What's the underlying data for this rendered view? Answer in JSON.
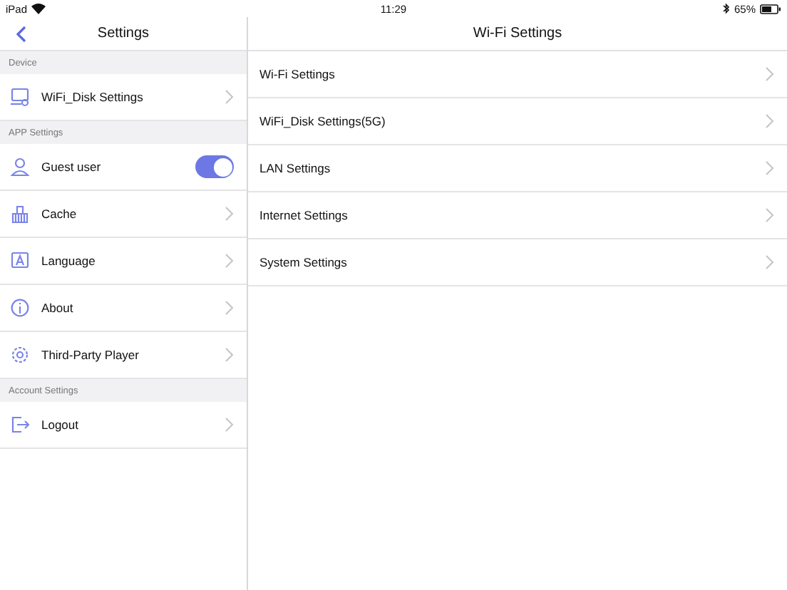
{
  "status_bar": {
    "device": "iPad",
    "time": "11:29",
    "battery_text": "65%"
  },
  "sidebar": {
    "title": "Settings",
    "sections": [
      {
        "header": "Device",
        "items": [
          {
            "label": "WiFi_Disk Settings",
            "kind": "nav"
          }
        ]
      },
      {
        "header": "APP Settings",
        "items": [
          {
            "label": "Guest user",
            "kind": "toggle",
            "on": true
          },
          {
            "label": "Cache",
            "kind": "nav"
          },
          {
            "label": "Language",
            "kind": "nav"
          },
          {
            "label": "About",
            "kind": "nav"
          },
          {
            "label": "Third-Party Player",
            "kind": "nav"
          }
        ]
      },
      {
        "header": "Account Settings",
        "items": [
          {
            "label": "Logout",
            "kind": "nav"
          }
        ]
      }
    ]
  },
  "detail": {
    "title": "Wi-Fi Settings",
    "items": [
      {
        "label": "Wi-Fi Settings"
      },
      {
        "label": "WiFi_Disk Settings(5G)"
      },
      {
        "label": "LAN Settings"
      },
      {
        "label": "Internet Settings"
      },
      {
        "label": "System Settings"
      }
    ]
  }
}
